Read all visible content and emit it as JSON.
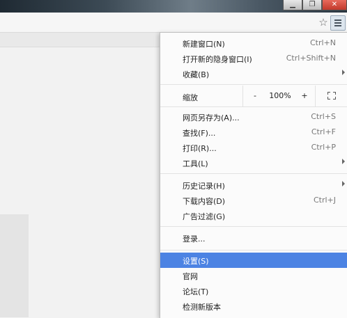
{
  "menu": {
    "group1": [
      {
        "label": "新建窗口(N)",
        "shortcut": "Ctrl+N"
      },
      {
        "label": "打开新的隐身窗口(I)",
        "shortcut": "Ctrl+Shift+N"
      },
      {
        "label": "收藏(B)",
        "shortcut": ""
      }
    ],
    "zoom": {
      "label": "缩放",
      "minus": "-",
      "percent": "100%",
      "plus": "+"
    },
    "group2": [
      {
        "label": "网页另存为(A)...",
        "shortcut": "Ctrl+S"
      },
      {
        "label": "查找(F)...",
        "shortcut": "Ctrl+F"
      },
      {
        "label": "打印(R)...",
        "shortcut": "Ctrl+P"
      },
      {
        "label": "工具(L)",
        "shortcut": ""
      }
    ],
    "group3": [
      {
        "label": "历史记录(H)",
        "shortcut": ""
      },
      {
        "label": "下载内容(D)",
        "shortcut": "Ctrl+J"
      },
      {
        "label": "广告过滤(G)",
        "shortcut": ""
      }
    ],
    "login": {
      "label": "登录..."
    },
    "group4": [
      {
        "label": "设置(S)"
      },
      {
        "label": "官网"
      },
      {
        "label": "论坛(T)"
      },
      {
        "label": "检测新版本"
      }
    ]
  },
  "toolbar": {
    "star_icon": "star-icon",
    "menu_icon": "hamburger-menu-icon"
  },
  "selected_color": "#4c83e3"
}
